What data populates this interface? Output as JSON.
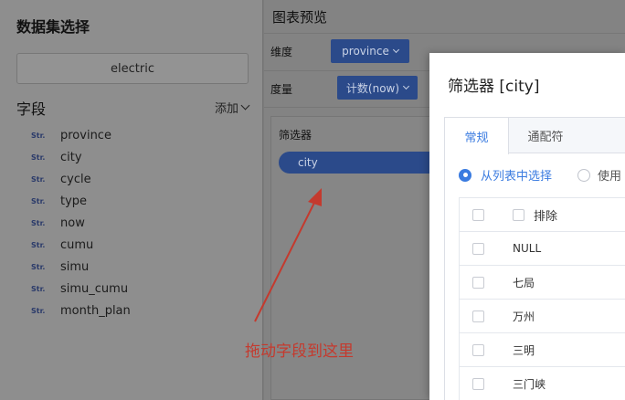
{
  "left_panel": {
    "title": "数据集选择",
    "dataset_value": "electric",
    "fields_title": "字段",
    "add_label": "添加",
    "field_type_tag": "Str.",
    "fields": [
      "province",
      "city",
      "cycle",
      "type",
      "now",
      "cumu",
      "simu",
      "simu_cumu",
      "month_plan"
    ]
  },
  "preview": {
    "title": "图表预览",
    "dimension_label": "维度",
    "dimension_value": "province",
    "measure_label": "度量",
    "measure_value": "计数(now)",
    "filter_label": "筛选器",
    "filter_pill": "city"
  },
  "annotation": {
    "text": "拖动字段到这里",
    "color": "#c43a2e"
  },
  "dialog": {
    "title": "筛选器 [city]",
    "tabs": [
      "常规",
      "通配符"
    ],
    "radio_selected": "从列表中选择",
    "radio_other": "使用",
    "table_header": "排除",
    "rows": [
      "NULL",
      "七局",
      "万州",
      "三明",
      "三门峡"
    ]
  },
  "colors": {
    "accent": "#3a7be0",
    "pill_blue": "#2b4a8a"
  }
}
